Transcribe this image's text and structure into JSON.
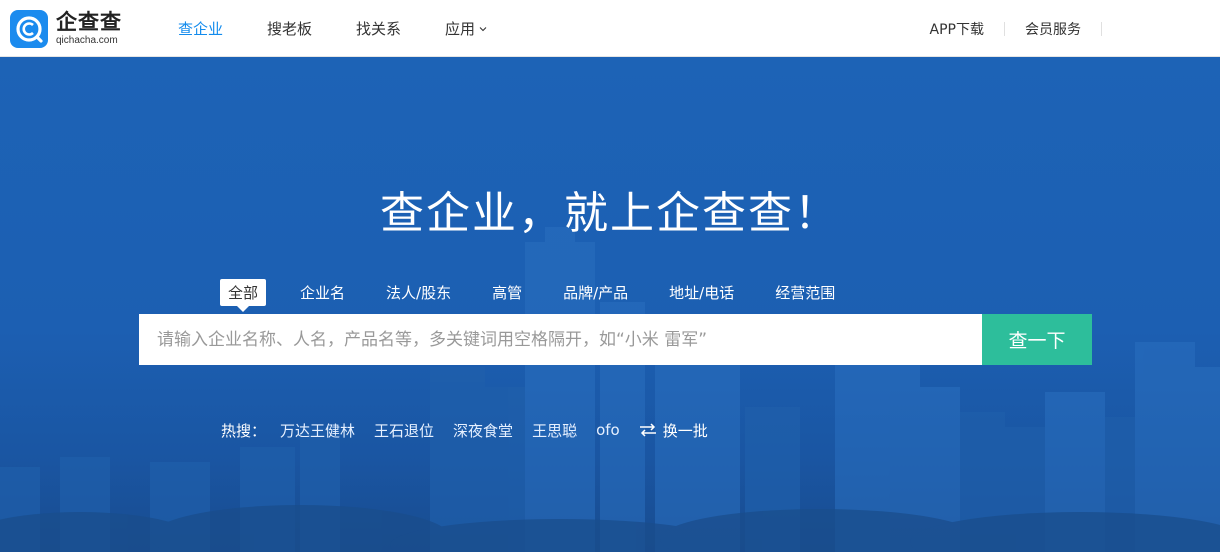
{
  "header": {
    "logo": {
      "cn": "企查查",
      "en": "qichacha.com",
      "icon": "qichacha-logo-icon"
    },
    "nav": [
      {
        "label": "查企业",
        "active": true
      },
      {
        "label": "搜老板",
        "active": false
      },
      {
        "label": "找关系",
        "active": false
      },
      {
        "label": "应用",
        "active": false,
        "has_dropdown": true
      }
    ],
    "right_links": [
      {
        "label": "APP下载"
      },
      {
        "label": "会员服务"
      }
    ]
  },
  "hero": {
    "title": "查企业，就上企查查！",
    "tabs": [
      {
        "label": "全部",
        "active": true
      },
      {
        "label": "企业名"
      },
      {
        "label": "法人/股东"
      },
      {
        "label": "高管"
      },
      {
        "label": "品牌/产品"
      },
      {
        "label": "地址/电话"
      },
      {
        "label": "经营范围"
      }
    ],
    "search": {
      "placeholder": "请输入企业名称、人名，产品名等，多关键词用空格隔开，如“小米 雷军”",
      "value": "",
      "button_label": "查一下"
    },
    "hot": {
      "label": "热搜：",
      "items": [
        "万达王健林",
        "王石退位",
        "深夜食堂",
        "王思聪",
        "ofo"
      ],
      "swap_label": "换一批",
      "swap_icon": "swap-arrows-icon"
    }
  },
  "colors": {
    "brand_blue": "#128bed",
    "hero_blue": "#1d63b6",
    "search_button_green": "#2dbe9b"
  }
}
